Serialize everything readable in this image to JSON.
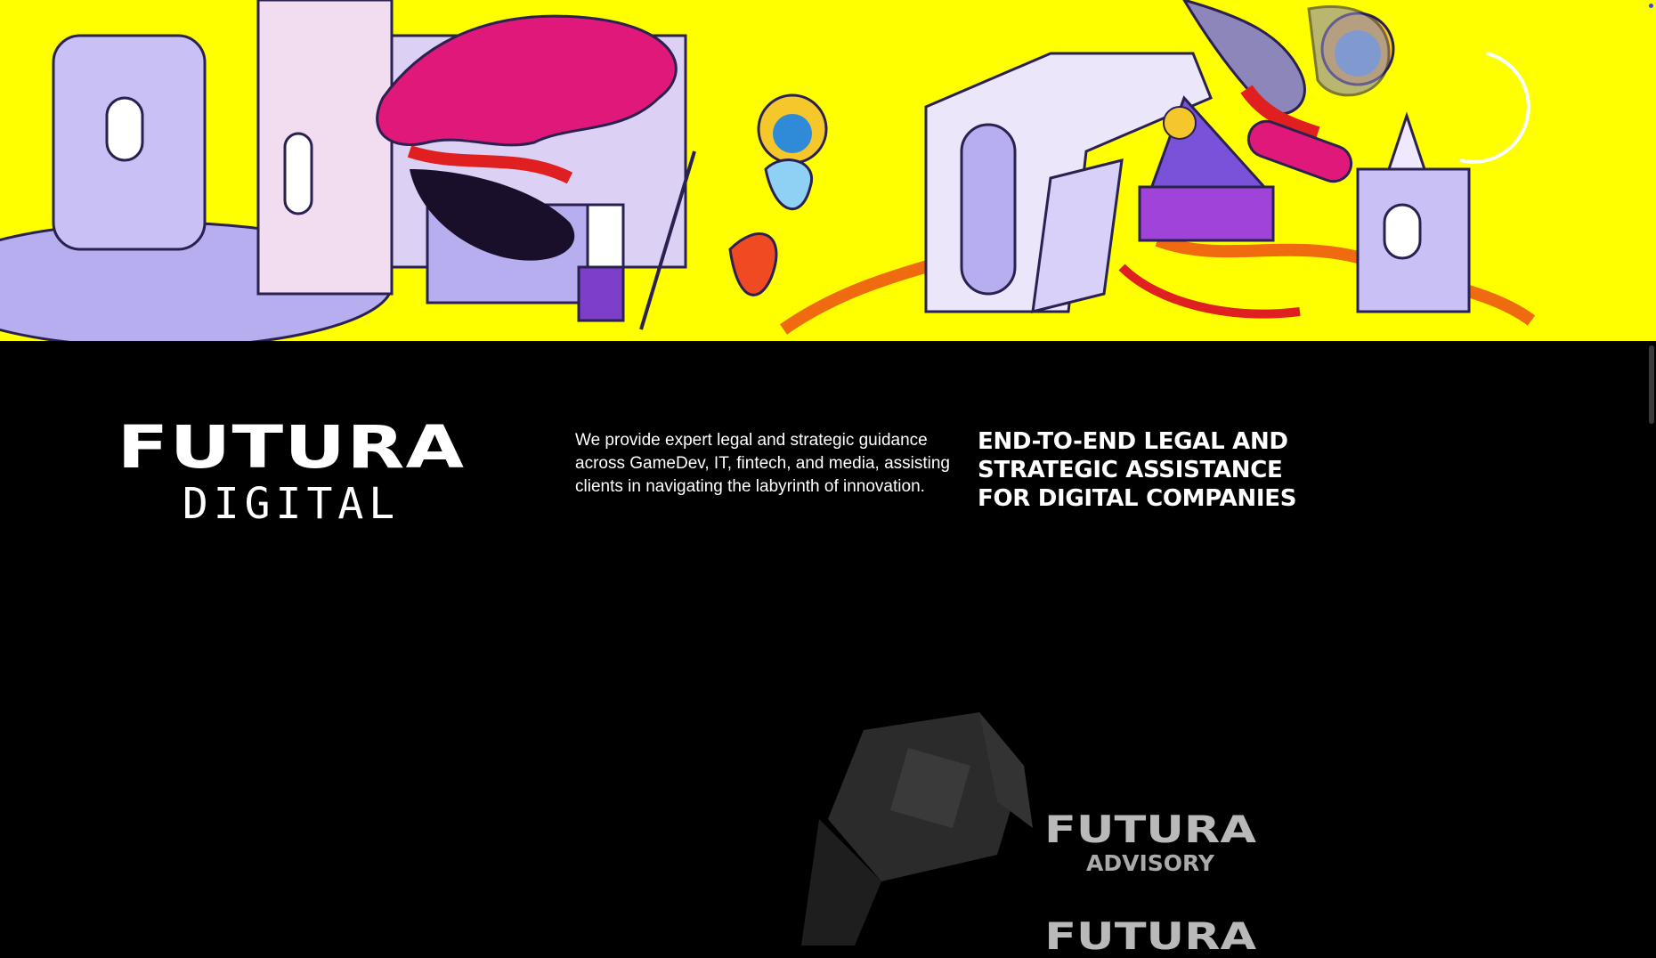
{
  "hero": {
    "background": "#ffff00",
    "illustration": "surreal-isometric-castle-illustration"
  },
  "brand": {
    "name_top": "FUTURA",
    "name_bottom": "DIGITAL"
  },
  "intro": {
    "text": "We provide expert legal and strategic guidance across GameDev, IT, fintech, and media, assisting clients in navigating the labyrinth of innovation."
  },
  "tagline": {
    "text": "END-TO-END LEGAL AND STRATEGIC ASSISTANCE FOR DIGITAL COMPANIES"
  },
  "subbrands": [
    {
      "name": "FUTURA",
      "sub": "ADVISORY"
    },
    {
      "name": "FUTURA",
      "sub": ""
    }
  ],
  "colors": {
    "background": "#000000",
    "accent_yellow": "#ffff00",
    "lavender": "#b8b0f0",
    "magenta": "#e0187a",
    "text": "#ffffff"
  }
}
